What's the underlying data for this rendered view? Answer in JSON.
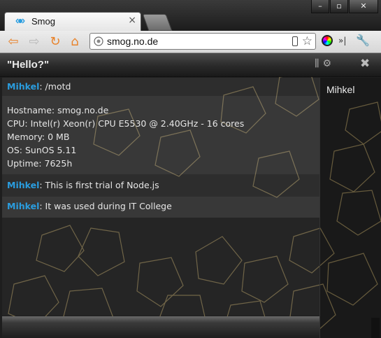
{
  "browser": {
    "tab": {
      "title": "Smog",
      "close": "×"
    },
    "window_buttons": [
      "–",
      "▫",
      "✕"
    ],
    "url": "smog.no.de",
    "colors": {
      "accent": "#e8832b"
    }
  },
  "room": {
    "title": "\"Hello?\"",
    "close": "✖"
  },
  "messages": [
    {
      "nick": "Mihkel",
      "text": ": /motd"
    },
    {
      "nick": "",
      "lines": [
        "Hostname: smog.no.de",
        "CPU: Intel(r) Xeon(r) CPU E5530 @ 2.40GHz - 16 cores",
        "Memory: 0 MB",
        "OS: SunOS 5.11",
        "Uptime: 7625h"
      ]
    },
    {
      "nick": "Mihkel",
      "text": ": This is first trial of Node.js"
    },
    {
      "nick": "Mihkel",
      "text": ": It was used during IT College"
    }
  ],
  "users": [
    "Mihkel"
  ],
  "colors": {
    "nick": "#2a9ddf",
    "background": "#1e1e1e",
    "pattern": "#8a7a50"
  }
}
